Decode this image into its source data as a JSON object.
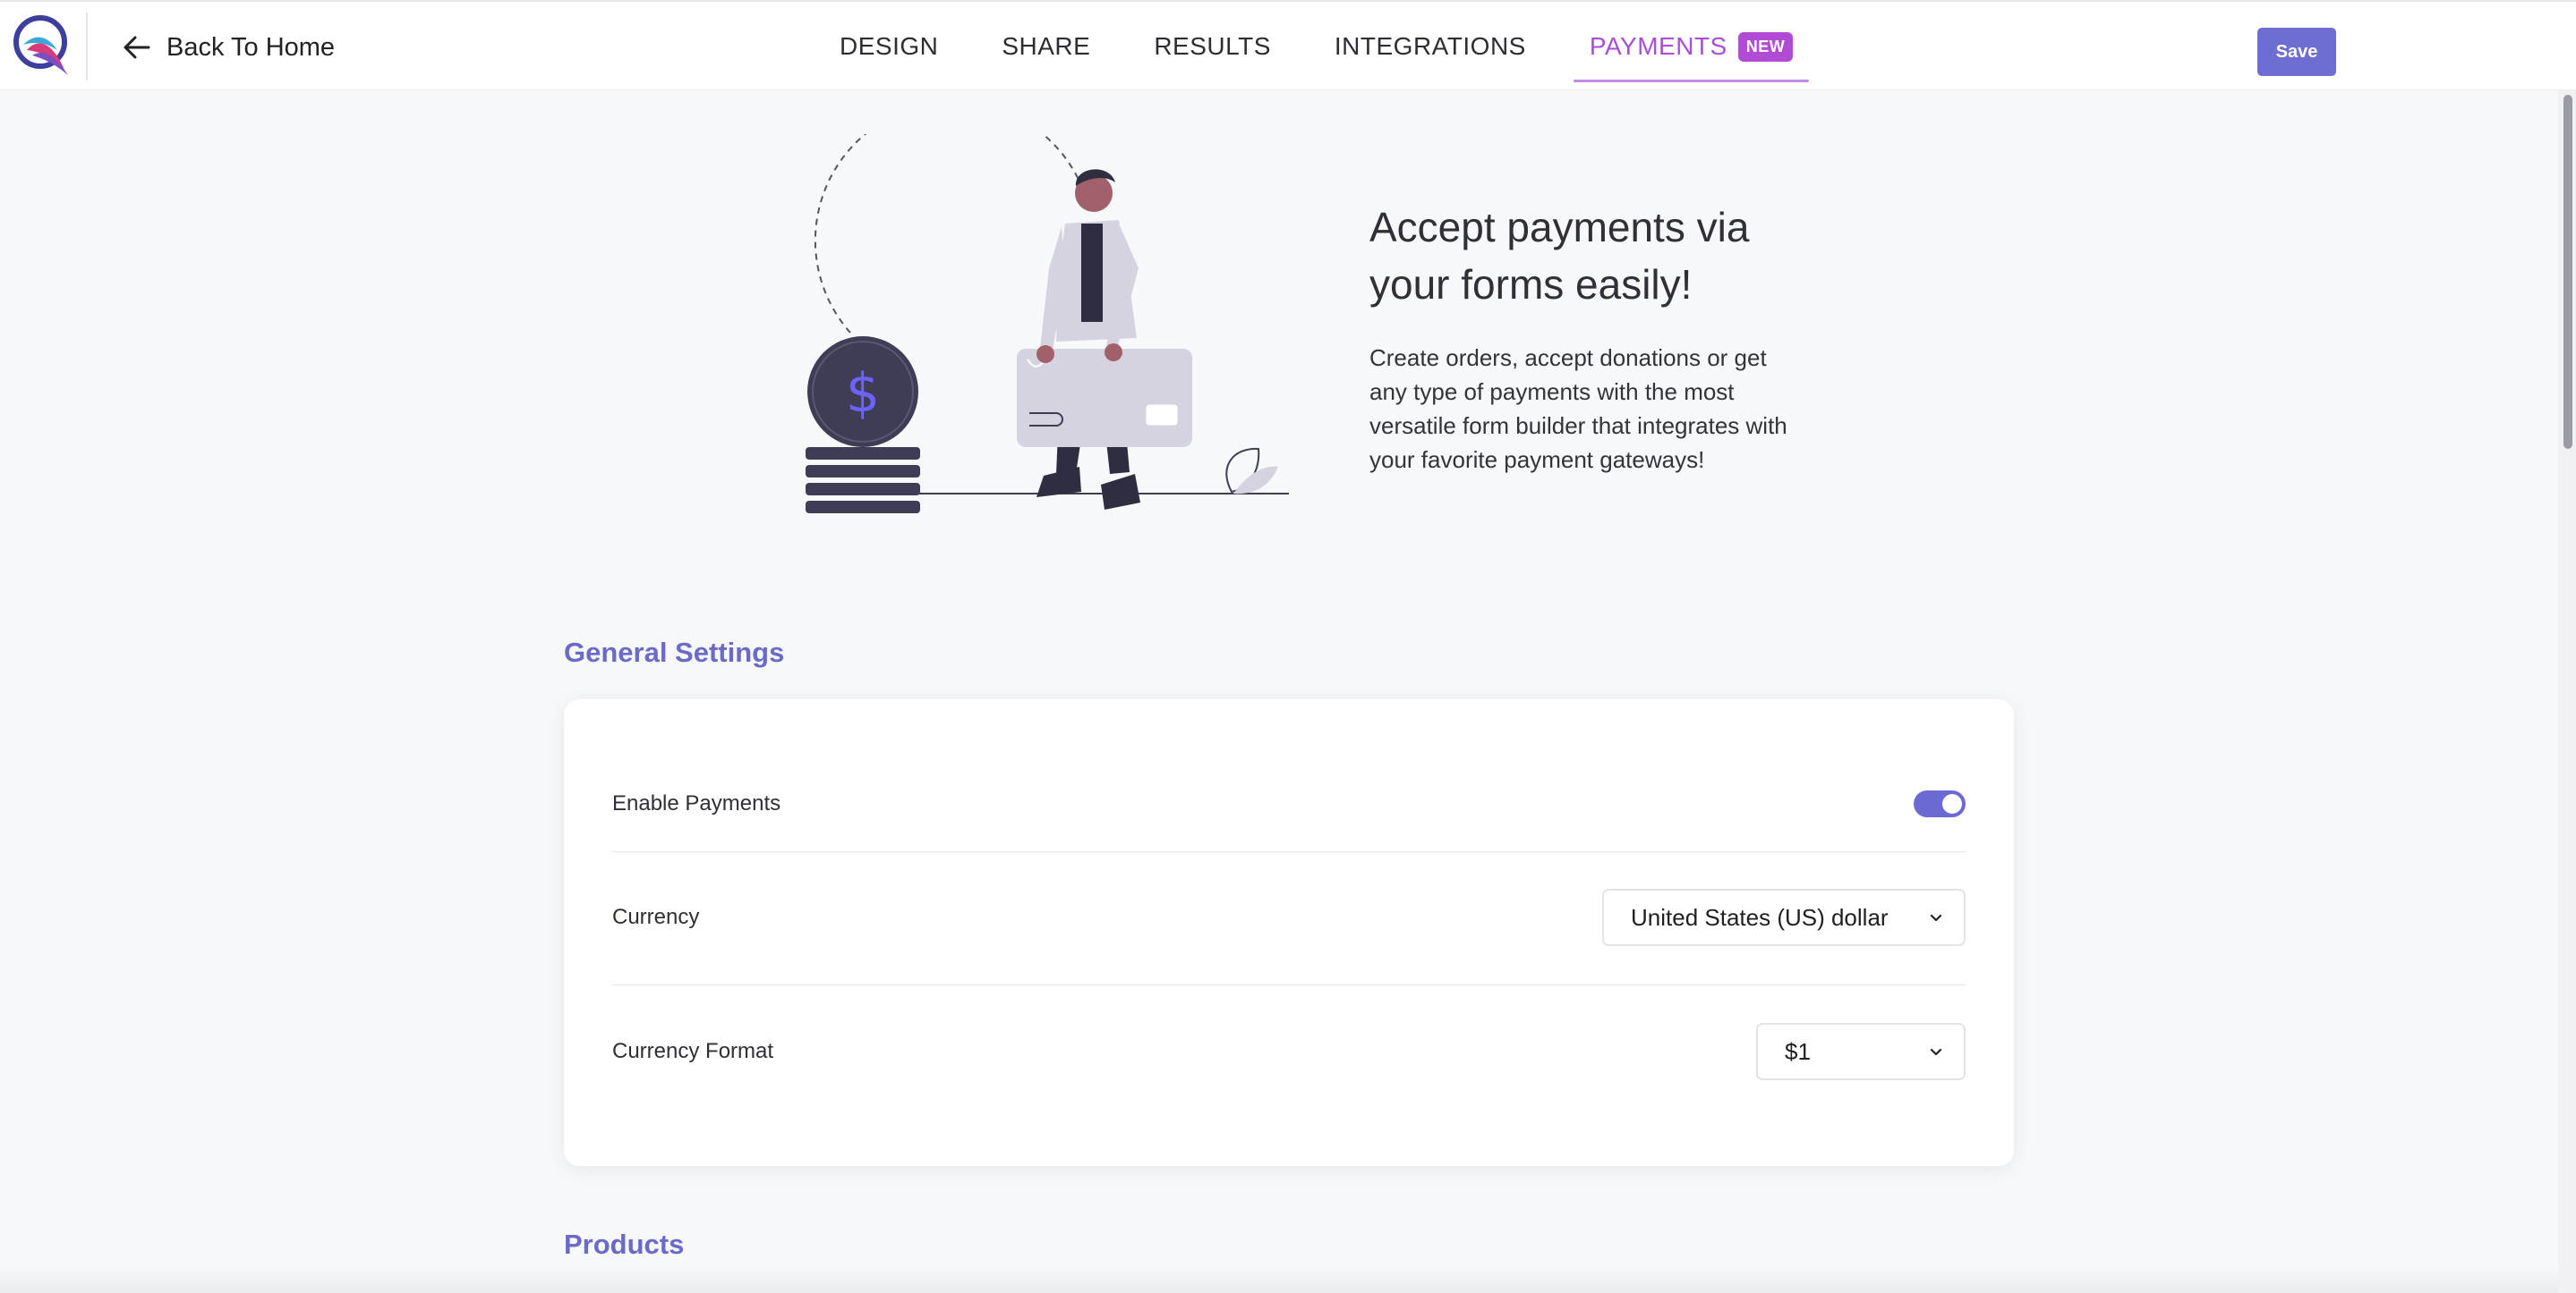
{
  "header": {
    "back_label": "Back To Home",
    "save_label": "Save",
    "tabs": [
      {
        "label": "DESIGN"
      },
      {
        "label": "SHARE"
      },
      {
        "label": "RESULTS"
      },
      {
        "label": "INTEGRATIONS"
      },
      {
        "label": "PAYMENTS",
        "badge": "NEW",
        "active": true
      }
    ]
  },
  "hero": {
    "title": "Accept payments via your forms easily!",
    "description": "Create orders, accept donations or get any type of payments with the most versatile form builder that integrates with your favorite payment gateways!",
    "coin_symbol": "$"
  },
  "general_settings": {
    "title": "General Settings",
    "enable_payments": {
      "label": "Enable Payments",
      "enabled": true
    },
    "currency": {
      "label": "Currency",
      "value": "United States (US) dollar"
    },
    "currency_format": {
      "label": "Currency Format",
      "value": "$1"
    }
  },
  "products": {
    "title": "Products"
  },
  "colors": {
    "accent": "#6a6ac8",
    "active_tab": "#a84fd6",
    "badge": "#b14bd4",
    "save_button": "#6d6dd2"
  }
}
